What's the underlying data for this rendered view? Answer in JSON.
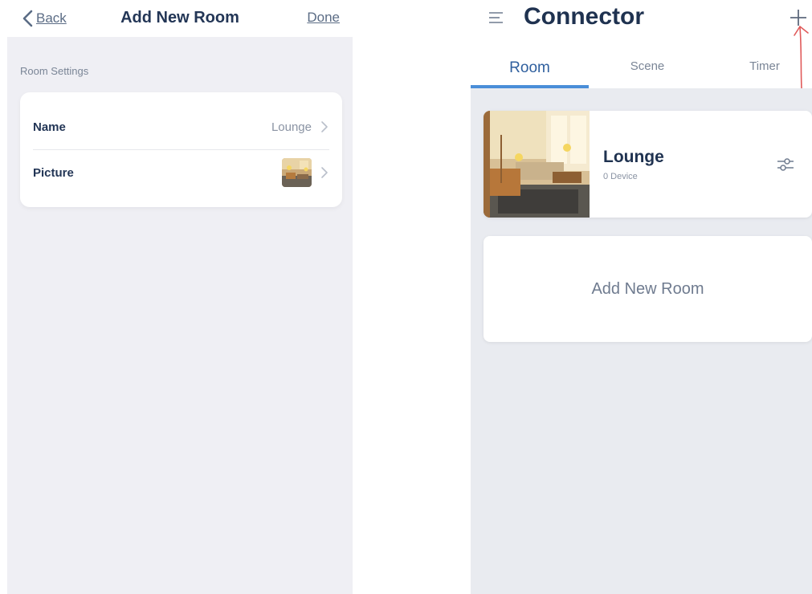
{
  "left_screen": {
    "nav": {
      "back_label": "Back",
      "title": "Add New Room",
      "done_label": "Done"
    },
    "section_label": "Room Settings",
    "rows": [
      {
        "label": "Name",
        "value": "Lounge"
      },
      {
        "label": "Picture",
        "value": ""
      }
    ]
  },
  "right_screen": {
    "header": {
      "title": "Connector"
    },
    "tabs": [
      {
        "label": "Room",
        "active": true
      },
      {
        "label": "Scene",
        "active": false
      },
      {
        "label": "Timer",
        "active": false
      }
    ],
    "room_card": {
      "name": "Lounge",
      "devices": "0 Device"
    },
    "add_room_label": "Add New Room"
  },
  "colors": {
    "text_dark": "#1f3250",
    "accent_blue": "#4a8ed8",
    "annotation_red": "#e05a5a"
  },
  "icons": [
    "chevron-left-icon",
    "chevron-right-icon",
    "menu-icon",
    "plus-icon",
    "sliders-icon"
  ]
}
